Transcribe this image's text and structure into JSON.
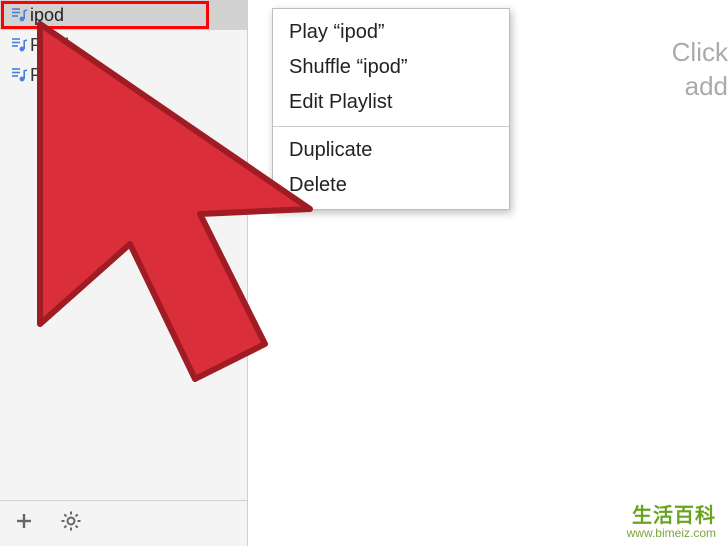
{
  "sidebar": {
    "items": [
      {
        "label": "ipod",
        "selected": true
      },
      {
        "label": "Playl",
        "selected": false
      },
      {
        "label": "Playl",
        "selected": false
      }
    ]
  },
  "context_menu": {
    "items": [
      "Play “ipod”",
      "Shuffle “ipod”",
      "Edit Playlist"
    ],
    "items2": [
      "Duplicate",
      "Delete"
    ]
  },
  "hint": {
    "line1": "Click",
    "line2": "add"
  },
  "watermark": {
    "cn": "生活百科",
    "url": "www.bimeiz.com"
  }
}
